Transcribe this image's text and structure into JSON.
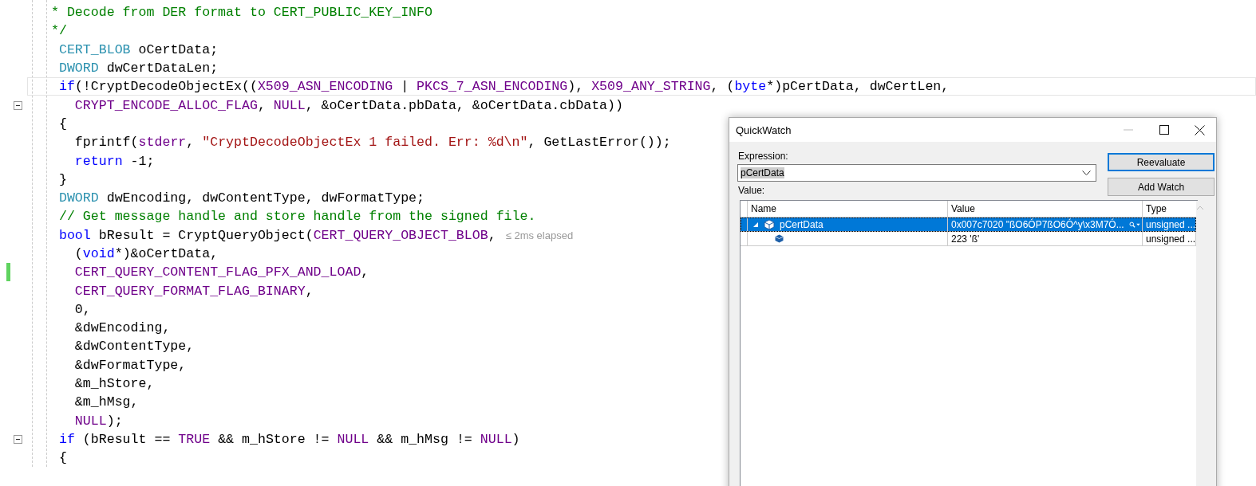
{
  "editor": {
    "lines": [
      {
        "tokens": [
          {
            "kind": "comment",
            "text": "* Decode from DER format to CERT_PUBLIC_KEY_INFO"
          }
        ]
      },
      {
        "tokens": [
          {
            "kind": "comment",
            "text": "*/"
          }
        ]
      },
      {
        "tokens": [
          {
            "kind": "type",
            "text": " CERT_BLOB"
          },
          {
            "kind": "plain",
            "text": " oCertData;"
          }
        ]
      },
      {
        "tokens": [
          {
            "kind": "type",
            "text": " DWORD"
          },
          {
            "kind": "plain",
            "text": " dwCertDataLen;"
          }
        ]
      },
      {
        "current": true,
        "tokens": [
          {
            "kind": "keyword",
            "text": " if"
          },
          {
            "kind": "plain",
            "text": "(!CryptDecodeObjectEx(("
          },
          {
            "kind": "macro",
            "text": "X509_ASN_ENCODING"
          },
          {
            "kind": "plain",
            "text": " | "
          },
          {
            "kind": "macro",
            "text": "PKCS_7_ASN_ENCODING"
          },
          {
            "kind": "plain",
            "text": "), "
          },
          {
            "kind": "macro",
            "text": "X509_ANY_STRING"
          },
          {
            "kind": "plain",
            "text": ", ("
          },
          {
            "kind": "keyword",
            "text": "byte"
          },
          {
            "kind": "plain",
            "text": "*)pCertData, dwCertLen,"
          }
        ]
      },
      {
        "collapsible": true,
        "tokens": [
          {
            "kind": "macro",
            "text": "   CRYPT_ENCODE_ALLOC_FLAG"
          },
          {
            "kind": "plain",
            "text": ", "
          },
          {
            "kind": "macro",
            "text": "NULL"
          },
          {
            "kind": "plain",
            "text": ", &oCertData.pbData, &oCertData.cbData))"
          }
        ]
      },
      {
        "tokens": [
          {
            "kind": "plain",
            "text": " {"
          }
        ]
      },
      {
        "tokens": [
          {
            "kind": "plain",
            "text": "   fprintf("
          },
          {
            "kind": "macro",
            "text": "stderr"
          },
          {
            "kind": "plain",
            "text": ", "
          },
          {
            "kind": "string",
            "text": "\"CryptDecodeObjectEx 1 failed. Err: %d\\n\""
          },
          {
            "kind": "plain",
            "text": ", GetLastError());"
          }
        ]
      },
      {
        "tokens": [
          {
            "kind": "keyword",
            "text": "   return"
          },
          {
            "kind": "plain",
            "text": " -1;"
          }
        ]
      },
      {
        "tokens": [
          {
            "kind": "plain",
            "text": " }"
          }
        ]
      },
      {
        "tokens": [
          {
            "kind": "type",
            "text": " DWORD"
          },
          {
            "kind": "plain",
            "text": " dwEncoding, dwContentType, dwFormatType;"
          }
        ]
      },
      {
        "tokens": [
          {
            "kind": "comment",
            "text": " // Get message handle and store handle from the signed file."
          }
        ]
      },
      {
        "hint": "≤ 2ms elapsed",
        "tokens": [
          {
            "kind": "keyword",
            "text": " bool"
          },
          {
            "kind": "plain",
            "text": " bResult = CryptQueryObject("
          },
          {
            "kind": "macro",
            "text": "CERT_QUERY_OBJECT_BLOB"
          },
          {
            "kind": "plain",
            "text": ","
          }
        ]
      },
      {
        "tokens": [
          {
            "kind": "plain",
            "text": "   ("
          },
          {
            "kind": "keyword",
            "text": "void"
          },
          {
            "kind": "plain",
            "text": "*)&oCertData,"
          }
        ]
      },
      {
        "changed": true,
        "tokens": [
          {
            "kind": "macro",
            "text": "   CERT_QUERY_CONTENT_FLAG_PFX_AND_LOAD"
          },
          {
            "kind": "plain",
            "text": ","
          }
        ]
      },
      {
        "tokens": [
          {
            "kind": "macro",
            "text": "   CERT_QUERY_FORMAT_FLAG_BINARY"
          },
          {
            "kind": "plain",
            "text": ","
          }
        ]
      },
      {
        "tokens": [
          {
            "kind": "plain",
            "text": "   0,"
          }
        ]
      },
      {
        "tokens": [
          {
            "kind": "plain",
            "text": "   &dwEncoding,"
          }
        ]
      },
      {
        "tokens": [
          {
            "kind": "plain",
            "text": "   &dwContentType,"
          }
        ]
      },
      {
        "tokens": [
          {
            "kind": "plain",
            "text": "   &dwFormatType,"
          }
        ]
      },
      {
        "tokens": [
          {
            "kind": "plain",
            "text": "   &m_hStore,"
          }
        ]
      },
      {
        "tokens": [
          {
            "kind": "plain",
            "text": "   &m_hMsg,"
          }
        ]
      },
      {
        "tokens": [
          {
            "kind": "macro",
            "text": "   NULL"
          },
          {
            "kind": "plain",
            "text": ");"
          }
        ]
      },
      {
        "collapsible": true,
        "tokens": [
          {
            "kind": "keyword",
            "text": " if"
          },
          {
            "kind": "plain",
            "text": " (bResult == "
          },
          {
            "kind": "macro",
            "text": "TRUE"
          },
          {
            "kind": "plain",
            "text": " && m_hStore != "
          },
          {
            "kind": "macro",
            "text": "NULL"
          },
          {
            "kind": "plain",
            "text": " && m_hMsg != "
          },
          {
            "kind": "macro",
            "text": "NULL"
          },
          {
            "kind": "plain",
            "text": ")"
          }
        ]
      },
      {
        "tokens": [
          {
            "kind": "plain",
            "text": " {"
          }
        ]
      }
    ]
  },
  "quickwatch": {
    "title": "QuickWatch",
    "expression_label": "Expression:",
    "expression": "pCertData",
    "value_label": "Value:",
    "buttons": [
      {
        "label": "Reevaluate",
        "default": true
      },
      {
        "label": "Add Watch",
        "default": false
      }
    ],
    "columns": [
      "Name",
      "Value",
      "Type"
    ],
    "rows": [
      {
        "name": "pCertData",
        "value": "0x007c7020 \"ßO6ÓP7ßO6Ó^y\\x3M7Ó...",
        "type": "unsigned ...",
        "selected": true,
        "expanded": true,
        "children": [
          {
            "value": "223 'ß'",
            "type": "unsigned ...",
            "selected": false
          }
        ]
      }
    ]
  }
}
